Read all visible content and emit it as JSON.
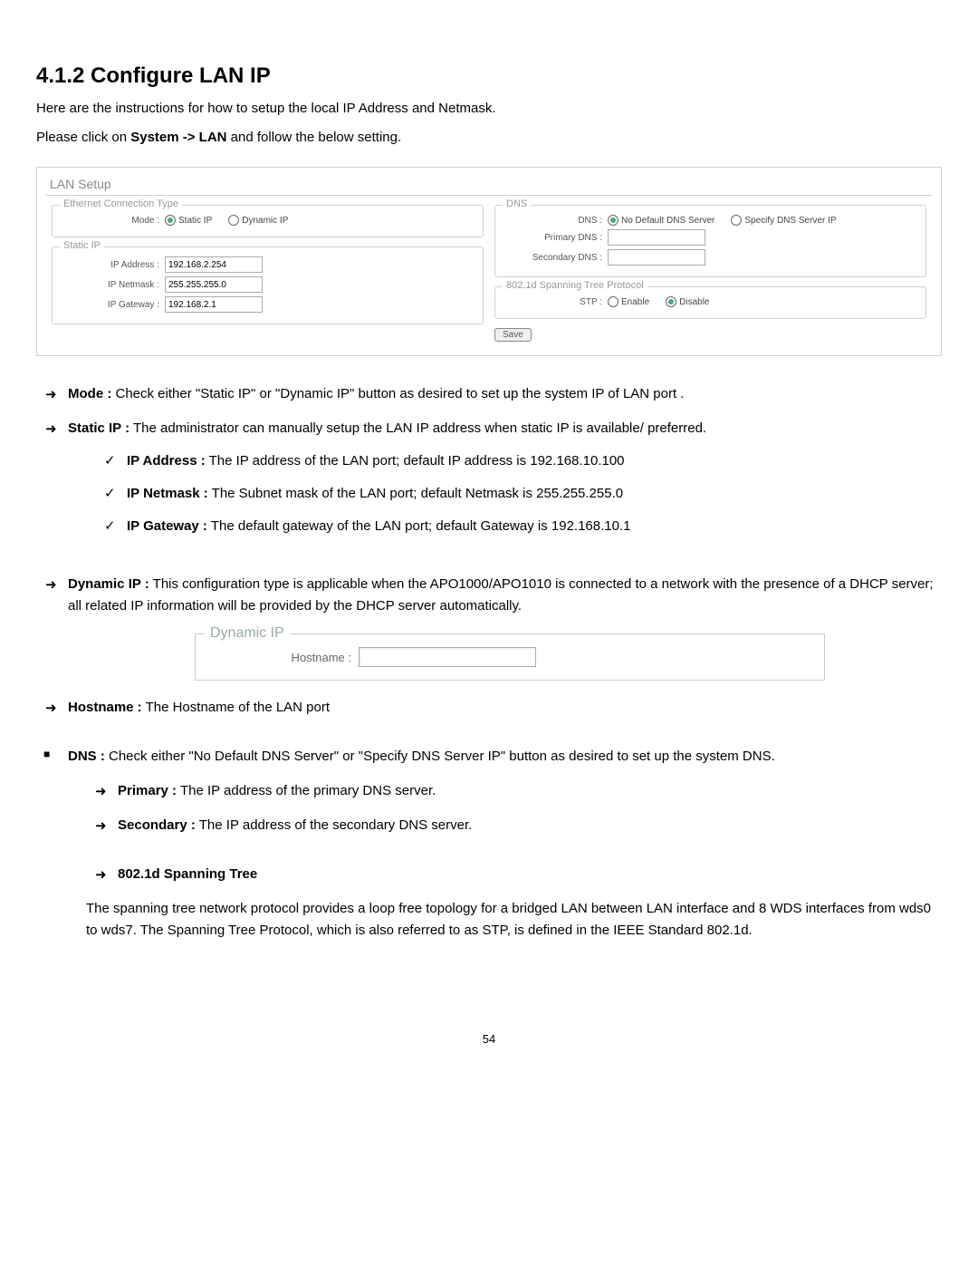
{
  "heading": "4.1.2 Configure LAN IP",
  "intro1": "Here are the instructions for how to setup the local IP Address and Netmask.",
  "intro2_pre": "Please click on ",
  "intro2_bold": "System -> LAN",
  "intro2_post": " and follow the below setting.",
  "lan_setup": {
    "title": "LAN Setup",
    "eth_legend": "Ethernet Connection Type",
    "mode_label": "Mode :",
    "mode_static": "Static IP",
    "mode_dynamic": "Dynamic IP",
    "static_legend": "Static IP",
    "ip_addr_label": "IP Address :",
    "ip_addr_val": "192.168.2.254",
    "ip_netmask_label": "IP Netmask :",
    "ip_netmask_val": "255.255.255.0",
    "ip_gw_label": "IP Gateway :",
    "ip_gw_val": "192.168.2.1",
    "dns_legend": "DNS",
    "dns_label": "DNS :",
    "dns_no_default": "No Default DNS Server",
    "dns_specify": "Specify DNS Server IP",
    "primary_dns_label": "Primary DNS :",
    "secondary_dns_label": "Secondary DNS :",
    "stp_legend": "802.1d Spanning Tree Protocol",
    "stp_label": "STP :",
    "stp_enable": "Enable",
    "stp_disable": "Disable",
    "save": "Save"
  },
  "bullets": {
    "mode_t": "Mode :",
    "mode_d": " Check either \"Static IP\" or \"Dynamic IP\" button as desired to set up the system IP of LAN port .",
    "static_t": "Static IP :",
    "static_d": " The administrator can manually setup the LAN IP address when static IP is available/ preferred.",
    "ipaddr_t": "IP Address :",
    "ipaddr_d": " The IP address of the LAN port; default IP address is 192.168.10.100",
    "ipnetm_t": "IP Netmask :",
    "ipnetm_d": " The Subnet mask of the LAN port; default Netmask is 255.255.255.0",
    "ipgw_t": "IP Gateway :",
    "ipgw_d": " The default gateway of the LAN port; default Gateway is 192.168.10.1",
    "dyn_t": "Dynamic IP :",
    "dyn_d": " This configuration type is applicable when the APO1000/APO1010 is connected to a network with the presence of a DHCP server; all related IP information will be provided by the DHCP server automatically.",
    "host_t": "Hostname :",
    "host_d": " The Hostname of the LAN port",
    "dns_t": "DNS :",
    "dns_d": " Check either \"No Default DNS Server\" or \"Specify DNS Server IP\" button as desired to set up the system DNS.",
    "prim_t": "Primary :",
    "prim_d": " The IP address of the primary DNS server.",
    "sec_t": "Secondary :",
    "sec_d": " The IP address of the secondary DNS server.",
    "stp_t": "802.1d Spanning Tree",
    "stp_d": "The spanning tree network protocol provides a loop free topology for a bridged LAN between LAN interface and 8 WDS interfaces from wds0 to wds7. The Spanning Tree Protocol, which is also referred to as STP, is defined in the IEEE Standard 802.1d."
  },
  "dynbox": {
    "legend": "Dynamic IP",
    "hostname_label": "Hostname :"
  },
  "pagenum": "54"
}
